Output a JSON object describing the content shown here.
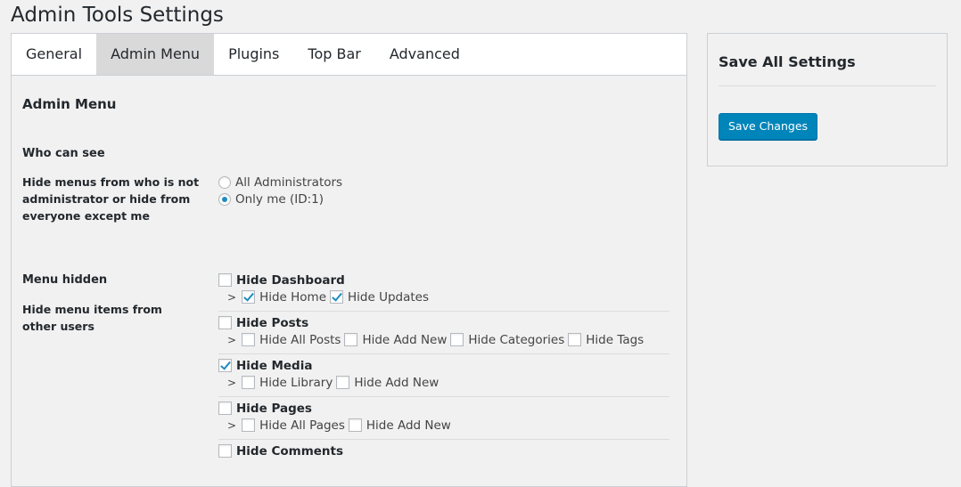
{
  "page": {
    "title": "Admin Tools Settings"
  },
  "tabs": [
    {
      "label": "General",
      "active": false
    },
    {
      "label": "Admin Menu",
      "active": true
    },
    {
      "label": "Plugins",
      "active": false
    },
    {
      "label": "Top Bar",
      "active": false
    },
    {
      "label": "Advanced",
      "active": false
    }
  ],
  "section": {
    "title": "Admin Menu"
  },
  "who_can_see": {
    "heading": "Who can see",
    "description": "Hide menus from who is not administrator or hide from everyone except me",
    "options": [
      {
        "label": "All Administrators",
        "checked": false
      },
      {
        "label": "Only me (ID:1)",
        "checked": true
      }
    ]
  },
  "menu_hidden": {
    "heading": "Menu hidden",
    "description": "Hide menu items from other users",
    "arrow": ">",
    "groups": [
      {
        "label": "Hide Dashboard",
        "checked": false,
        "sub": [
          {
            "label": "Hide Home",
            "checked": true
          },
          {
            "label": "Hide Updates",
            "checked": true
          }
        ]
      },
      {
        "label": "Hide Posts",
        "checked": false,
        "sub": [
          {
            "label": "Hide All Posts",
            "checked": false
          },
          {
            "label": "Hide Add New",
            "checked": false
          },
          {
            "label": "Hide Categories",
            "checked": false
          },
          {
            "label": "Hide Tags",
            "checked": false
          }
        ]
      },
      {
        "label": "Hide Media",
        "checked": true,
        "sub": [
          {
            "label": "Hide Library",
            "checked": false
          },
          {
            "label": "Hide Add New",
            "checked": false
          }
        ]
      },
      {
        "label": "Hide Pages",
        "checked": false,
        "sub": [
          {
            "label": "Hide All Pages",
            "checked": false
          },
          {
            "label": "Hide Add New",
            "checked": false
          }
        ]
      },
      {
        "label": "Hide Comments",
        "checked": false,
        "sub": []
      }
    ]
  },
  "sidebar": {
    "title": "Save All Settings",
    "button_label": "Save Changes"
  },
  "colors": {
    "accent": "#0085ba",
    "check": "#1e8cbe"
  }
}
